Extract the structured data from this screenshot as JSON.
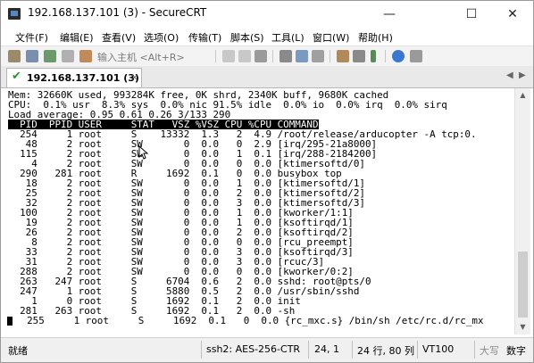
{
  "window": {
    "title": "192.168.137.101 (3) - SecureCRT",
    "minimize_glyph": "—",
    "maximize_glyph": "☐",
    "close_glyph": "✕"
  },
  "menu": [
    "文件(F)",
    "编辑(E)",
    "查看(V)",
    "选项(O)",
    "传输(T)",
    "脚本(S)",
    "工具(L)",
    "窗口(W)",
    "帮助(H)"
  ],
  "toolbar": {
    "quick_connect_placeholder": "输入主机 <Alt+R>"
  },
  "tab": {
    "status_glyph": "✔",
    "label": "192.168.137.101 (3)",
    "close_glyph": "×",
    "prev_glyph": "◀",
    "next_glyph": "▶"
  },
  "terminal": {
    "lines": [
      "Mem: 32660K used, 993284K free, 0K shrd, 2340K buff, 9680K cached",
      "CPU:  0.1% usr  8.3% sys  0.0% nic 91.5% idle  0.0% io  0.0% irq  0.0% sirq",
      "Load average: 0.95 0.61 0.26 3/133 290"
    ],
    "header": "  PID  PPID USER     STAT   VSZ %VSZ CPU %CPU COMMAND",
    "processes": [
      "  254     1 root     S    13332  1.3   2  4.9 /root/release/arducopter -A tcp:0.",
      "   48     2 root     SW       0  0.0   0  2.9 [irq/295-21a8000]",
      "  115     2 root     SW       0  0.0   1  0.1 [irq/288-2184200]",
      "    4     2 root     SW       0  0.0   0  0.0 [ktimersoftd/0]",
      "  290   281 root     R     1692  0.1   0  0.0 busybox top",
      "   18     2 root     SW       0  0.0   1  0.0 [ktimersoftd/1]",
      "   25     2 root     SW       0  0.0   2  0.0 [ktimersoftd/2]",
      "   32     2 root     SW       0  0.0   3  0.0 [ktimersoftd/3]",
      "  100     2 root     SW       0  0.0   1  0.0 [kworker/1:1]",
      "   19     2 root     SW       0  0.0   1  0.0 [ksoftirqd/1]",
      "   26     2 root     SW       0  0.0   2  0.0 [ksoftirqd/2]",
      "    8     2 root     SW       0  0.0   0  0.0 [rcu_preempt]",
      "   33     2 root     SW       0  0.0   3  0.0 [ksoftirqd/3]",
      "   31     2 root     SW       0  0.0   3  0.0 [rcuc/3]",
      "  288     2 root     SW       0  0.0   0  0.0 [kworker/0:2]",
      "  263   247 root     S     6704  0.6   2  0.0 sshd: root@pts/0",
      "  247     1 root     S     5880  0.5   2  0.0 /usr/sbin/sshd",
      "    1     0 root     S     1692  0.1   2  0.0 init",
      "  281   263 root     S     1692  0.1   2  0.0 -sh",
      "  255     1 root     S     1692  0.1   0  0.0 {rc_mxc.s} /bin/sh /etc/rc.d/rc_mx"
    ]
  },
  "scrollbar": {
    "up_glyph": "▲",
    "down_glyph": "▼"
  },
  "statusbar": {
    "ready": "就绪",
    "cipher": "ssh2: AES-256-CTR",
    "cursor_pos": "24,  1",
    "dims": "24 行, 80 列",
    "term": "VT100",
    "caps": "大写",
    "num": "数字"
  }
}
